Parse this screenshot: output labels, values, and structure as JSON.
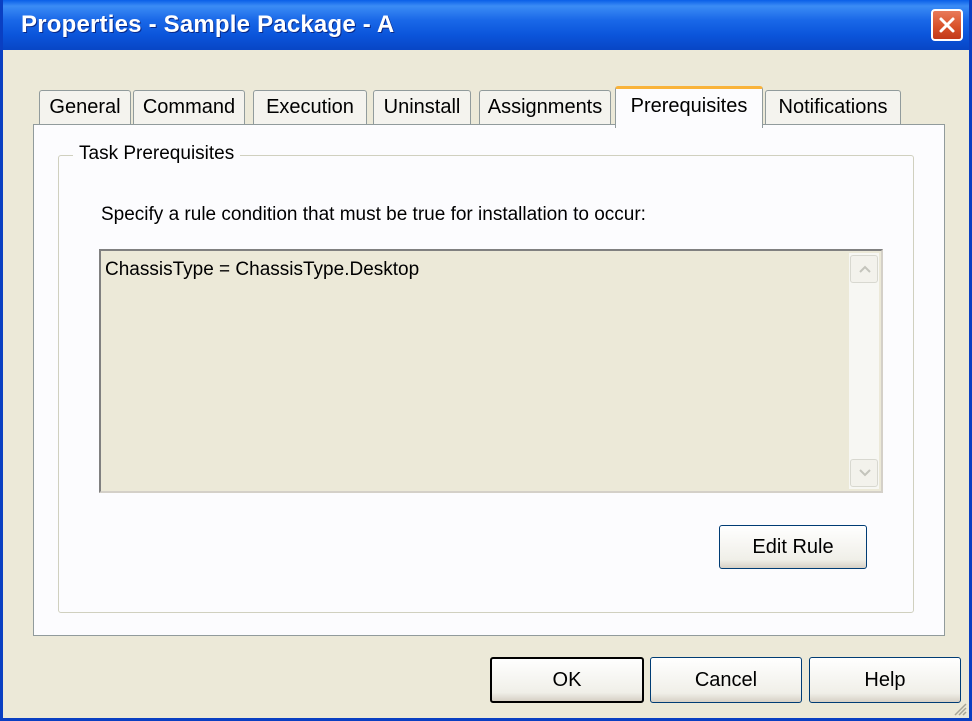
{
  "window": {
    "title": "Properties - Sample Package - A"
  },
  "tabs": [
    {
      "label": "General",
      "active": false
    },
    {
      "label": "Command",
      "active": false
    },
    {
      "label": "Execution",
      "active": false
    },
    {
      "label": "Uninstall",
      "active": false
    },
    {
      "label": "Assignments",
      "active": false
    },
    {
      "label": "Prerequisites",
      "active": true
    },
    {
      "label": "Notifications",
      "active": false
    }
  ],
  "group": {
    "label": "Task Prerequisites",
    "description": "Specify a rule condition that must be true for installation to occur:",
    "rule": "ChassisType = ChassisType.Desktop",
    "edit_button": "Edit Rule"
  },
  "buttons": {
    "ok": "OK",
    "cancel": "Cancel",
    "help": "Help"
  },
  "colors": {
    "title_bar": "#0a5fe8",
    "active_tab_accent": "#f9b33a",
    "close_button": "#d9532b",
    "window_background": "#ece9d8"
  }
}
